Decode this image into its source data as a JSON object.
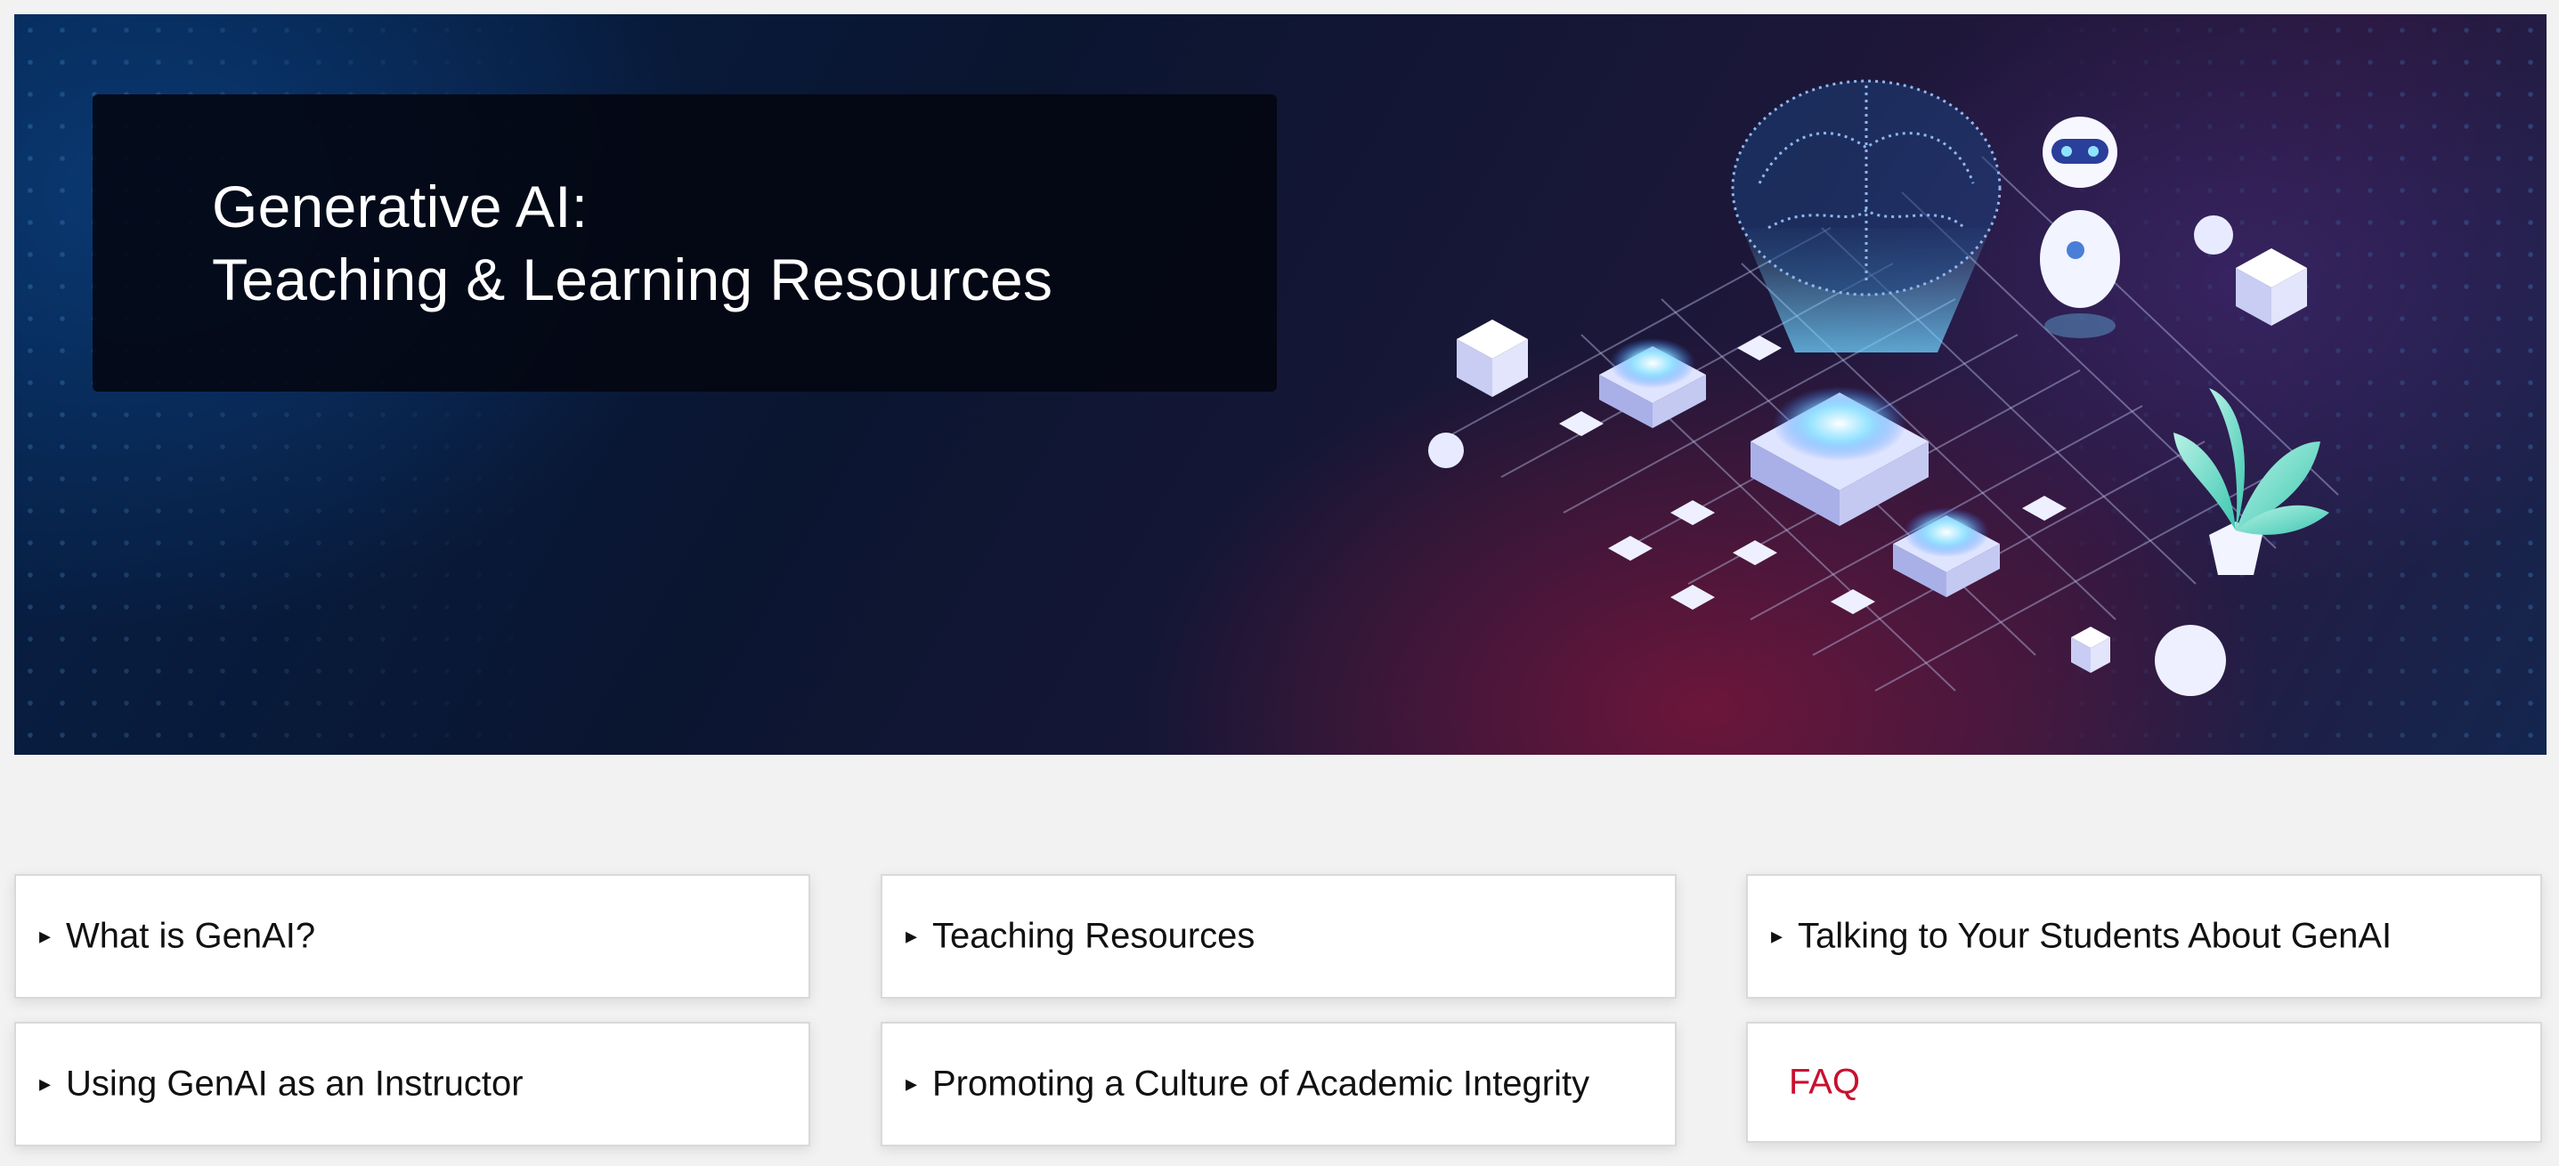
{
  "hero": {
    "title_line1": "Generative AI:",
    "title_line2": "Teaching & Learning Resources",
    "illustration_icon": "ai-brain-robot-circuit-illustration"
  },
  "accordions": [
    {
      "label": "What is GenAI?",
      "icon": "triangle-right-icon"
    },
    {
      "label": "Teaching Resources",
      "icon": "triangle-right-icon"
    },
    {
      "label": "Talking to Your Students About GenAI",
      "icon": "triangle-right-icon"
    },
    {
      "label": "Using GenAI as an Instructor",
      "icon": "triangle-right-icon"
    },
    {
      "label": "Promoting a Culture of Academic Integrity",
      "icon": "triangle-right-icon"
    }
  ],
  "faq": {
    "label": "FAQ"
  },
  "colors": {
    "faq_link": "#c8102e",
    "page_background": "#f2f2f2",
    "hero_dark": "#0a1530",
    "hero_magenta": "#78163a"
  }
}
